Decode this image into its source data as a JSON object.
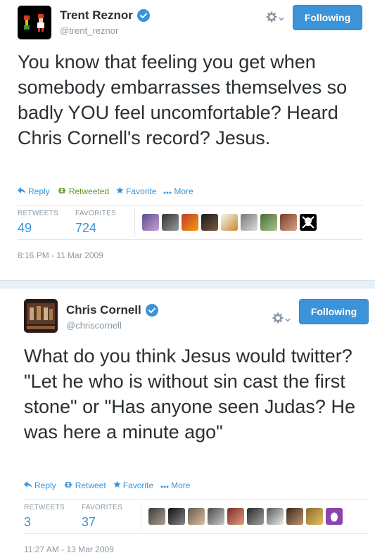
{
  "colors": {
    "accent": "#3b94d9",
    "retweeted": "#609928",
    "muted": "#8899a6",
    "separator": "#e8f1f8"
  },
  "tweets": [
    {
      "fullname": "Trent Reznor",
      "username": "@trent_reznor",
      "follow_label": "Following",
      "text": "You know that feeling you get when somebody embarrasses themselves so badly YOU feel uncomfortable? Heard Chris Cornell's record? Jesus.",
      "actions": {
        "reply": "Reply",
        "retweet": "Retweeted",
        "favorite": "Favorite",
        "more": "More"
      },
      "stats": {
        "retweets_label": "RETWEETS",
        "retweets": "49",
        "favorites_label": "FAVORITES",
        "favorites": "724"
      },
      "timestamp": "8:16 PM - 11 Mar 2009"
    },
    {
      "fullname": "Chris Cornell",
      "username": "@chriscornell",
      "follow_label": "Following",
      "text": "What do you think Jesus would twitter? \"Let he who is without sin cast the first stone\" or \"Has anyone seen Judas? He was here a minute ago\"",
      "actions": {
        "reply": "Reply",
        "retweet": "Retweet",
        "favorite": "Favorite",
        "more": "More"
      },
      "stats": {
        "retweets_label": "RETWEETS",
        "retweets": "3",
        "favorites_label": "FAVORITES",
        "favorites": "37"
      },
      "timestamp": "11:27 AM - 13 Mar 2009"
    }
  ]
}
